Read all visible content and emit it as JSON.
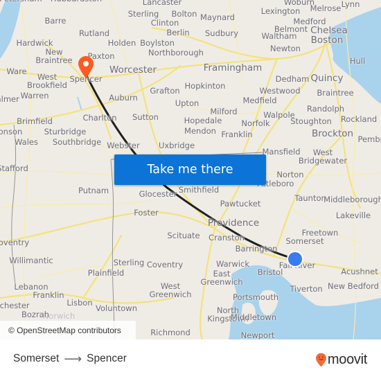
{
  "map": {
    "origin": {
      "name": "Somerset",
      "marker": "blue-dot-icon",
      "color": "#3b7bf0"
    },
    "destination": {
      "name": "Spencer",
      "marker": "orange-pin-icon",
      "color": "#ff5a1f"
    },
    "route_line_color": "#1f1f1f",
    "places": [
      {
        "name": "Barre"
      },
      {
        "name": "Rutland"
      },
      {
        "name": "Hardwick"
      },
      {
        "name": "New\nBraintree"
      },
      {
        "name": "Paxton"
      },
      {
        "name": "Holden"
      },
      {
        "name": "Sterling"
      },
      {
        "name": "Clinton"
      },
      {
        "name": "Bolton"
      },
      {
        "name": "Berlin"
      },
      {
        "name": "Boylston"
      },
      {
        "name": "Northborough"
      },
      {
        "name": "Lancaster"
      },
      {
        "name": "Worcester"
      },
      {
        "name": "Ware"
      },
      {
        "name": "West\nBrookfield"
      },
      {
        "name": "Spencer"
      },
      {
        "name": "Warren"
      },
      {
        "name": "Palmer"
      },
      {
        "name": "Auburn"
      },
      {
        "name": "Grafton"
      },
      {
        "name": "Upton"
      },
      {
        "name": "Charlton"
      },
      {
        "name": "Sutton"
      },
      {
        "name": "Brimfield"
      },
      {
        "name": "Sturbridge"
      },
      {
        "name": "Monson"
      },
      {
        "name": "Wales"
      },
      {
        "name": "Southbridge"
      },
      {
        "name": "Webster"
      },
      {
        "name": "Uxbridge"
      },
      {
        "name": "Maynard"
      },
      {
        "name": "Sudbury"
      },
      {
        "name": "Lexington"
      },
      {
        "name": "Woburn"
      },
      {
        "name": "Melrose"
      },
      {
        "name": "Lynn"
      },
      {
        "name": "Medford"
      },
      {
        "name": "Belmont"
      },
      {
        "name": "Chelsea"
      },
      {
        "name": "Waltham"
      },
      {
        "name": "Boston"
      },
      {
        "name": "Newton"
      },
      {
        "name": "Framingham"
      },
      {
        "name": "Hull"
      },
      {
        "name": "Dedham"
      },
      {
        "name": "Quincy"
      },
      {
        "name": "Hopkinton"
      },
      {
        "name": "Westwood"
      },
      {
        "name": "Braintree"
      },
      {
        "name": "Medfield"
      },
      {
        "name": "Milford"
      },
      {
        "name": "Randolph"
      },
      {
        "name": "Hopedale"
      },
      {
        "name": "Walpole"
      },
      {
        "name": "Norfolk"
      },
      {
        "name": "Stoughton"
      },
      {
        "name": "Rockland"
      },
      {
        "name": "Mendon"
      },
      {
        "name": "Franklin"
      },
      {
        "name": "Brockton"
      },
      {
        "name": "Mansfield"
      },
      {
        "name": "West\nBridgewater"
      },
      {
        "name": "Stafford"
      },
      {
        "name": "Putnam"
      },
      {
        "name": "Glocester"
      },
      {
        "name": "Smithfield"
      },
      {
        "name": "Norton"
      },
      {
        "name": "Attleboro"
      },
      {
        "name": "Taunton"
      },
      {
        "name": "Middleborough"
      },
      {
        "name": "Foster"
      },
      {
        "name": "Pawtucket"
      },
      {
        "name": "Lakeville"
      },
      {
        "name": "Providence"
      },
      {
        "name": "Scituate"
      },
      {
        "name": "Cranston"
      },
      {
        "name": "Freetown"
      },
      {
        "name": "Somerset"
      },
      {
        "name": "Coventry"
      },
      {
        "name": "Willimantic"
      },
      {
        "name": "Sterling"
      },
      {
        "name": "Coventry"
      },
      {
        "name": "Barrington"
      },
      {
        "name": "Warwick"
      },
      {
        "name": "Fall River"
      },
      {
        "name": "Plainfield"
      },
      {
        "name": "East\nGreenwich"
      },
      {
        "name": "Bristol"
      },
      {
        "name": "Acushnet"
      },
      {
        "name": "West\nGreenwich"
      },
      {
        "name": "New Bedford"
      },
      {
        "name": "Lebanon"
      },
      {
        "name": "Franklin"
      },
      {
        "name": "Tiverton"
      },
      {
        "name": "Portsmouth"
      },
      {
        "name": "Lisbon"
      },
      {
        "name": "Voluntown"
      },
      {
        "name": "Norwich"
      },
      {
        "name": "Bozrah"
      },
      {
        "name": "North\nKingstown"
      },
      {
        "name": "Middletown"
      },
      {
        "name": "Richmond"
      },
      {
        "name": "Newport"
      },
      {
        "name": "Colchester"
      },
      {
        "name": "Hubbardston"
      },
      {
        "name": "Petersham"
      },
      {
        "name": "Pembroke"
      }
    ],
    "attribution": "© OpenStreetMap contributors"
  },
  "cta": {
    "label": "Take me there"
  },
  "footer": {
    "from": "Somerset",
    "arrow": "⟶",
    "to": "Spencer",
    "brand": "moovit",
    "brand_color": "#f26b3a"
  }
}
